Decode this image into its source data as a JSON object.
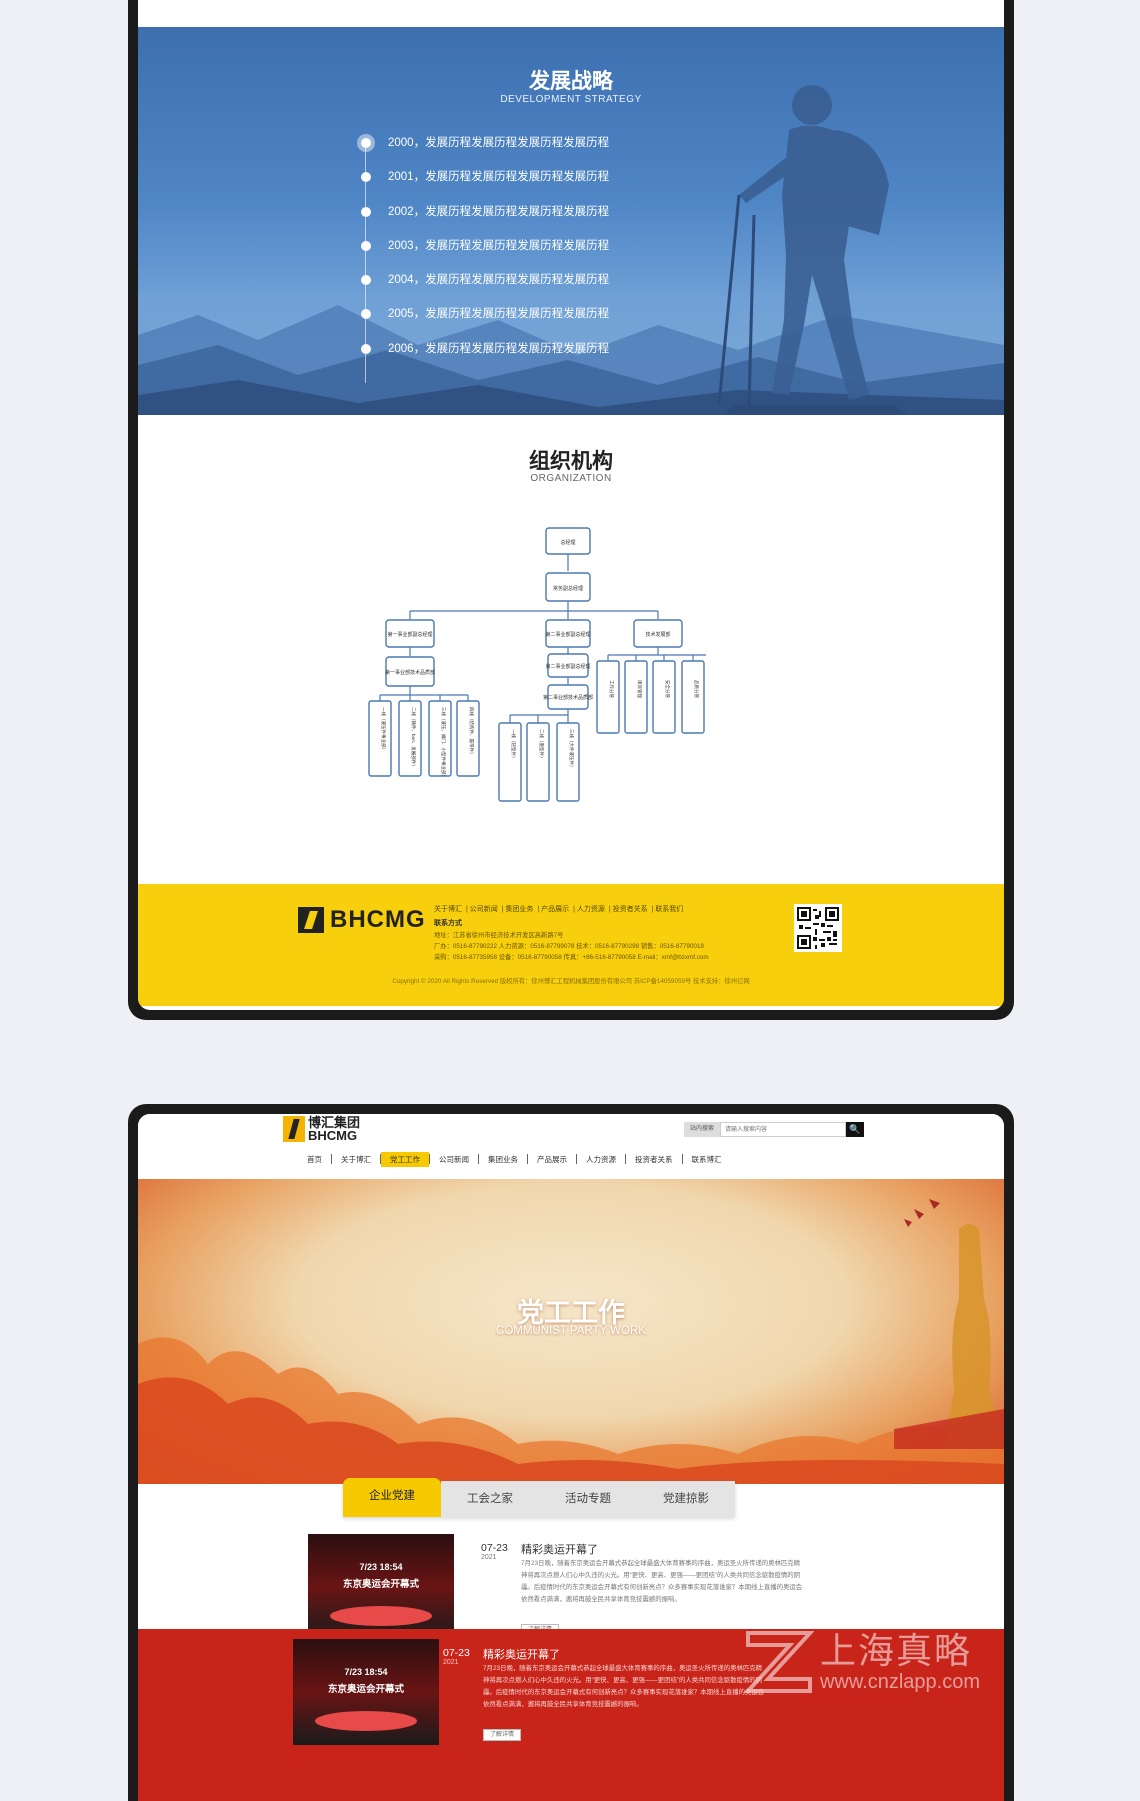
{
  "strategy": {
    "title": "发展战略",
    "subtitle": "DEVELOPMENT STRATEGY",
    "items": [
      "2000，发展历程发展历程发展历程发展历程",
      "2001，发展历程发展历程发展历程发展历程",
      "2002，发展历程发展历程发展历程发展历程",
      "2003，发展历程发展历程发展历程发展历程",
      "2004，发展历程发展历程发展历程发展历程",
      "2005，发展历程发展历程发展历程发展历程",
      "2006，发展历程发展历程发展历程发展历程"
    ]
  },
  "organization": {
    "title": "组织机构",
    "subtitle": "ORGANIZATION",
    "root": "总经理",
    "level2": "常务副总经理",
    "branches": [
      "第一事业部副总经理",
      "第二事业部副总经理",
      "技术发展部"
    ],
    "b1_sub": "第一事业部技术品质部",
    "b2_sub1": "第二事业部副总经理",
    "b2_sub2": "第二事业部技术品质部",
    "b1_leaves": [
      "一线（液压件事业部）",
      "二线（铸件、bart、发展部件）",
      "三线（液压、阀门、小型件事业部）",
      "四线（结构件、履带件）"
    ],
    "b2_leaves": [
      "一线（轻型件）",
      "二线（重型件）",
      "三线（大件液压件）"
    ],
    "b3_leaves": [
      "工作分管",
      "项目管理",
      "安全分管",
      "品质分管"
    ]
  },
  "footer": {
    "brand": "BHCMG",
    "nav": [
      "关于博汇",
      "公司新闻",
      "集团业务",
      "产品展示",
      "人力资源",
      "投资者关系",
      "联系我们"
    ],
    "contact_title": "联系方式",
    "lines": [
      "地址：江苏省徐州市经济技术开发区高新路7号",
      "厂办：0516-87790222   人力资源：0516-87799078   技术：0516-87790298   销售：0516-87790018",
      "采购：0516-87735958   设备：0516-87790058   传真：+86-516-87790058   E-mail：xmf@bzxmf.com"
    ],
    "copyright": "Copyright © 2020 All Rights Reserved 版权所有：徐州博汇工程机械集团股份有限公司 苏ICP备14059059号 技术支持：徐州亿网"
  },
  "site": {
    "logo_cn": "博汇集团",
    "logo_en": "BHCMG",
    "search_label": "站内搜索",
    "search_placeholder": "请输入搜索内容",
    "search_btn": "🔍",
    "nav": [
      "首页",
      "关于博汇",
      "党工工作",
      "公司新闻",
      "集团业务",
      "产品展示",
      "人力资源",
      "投资者关系",
      "联系博汇"
    ],
    "active_nav": 2
  },
  "party": {
    "title": "党工工作",
    "subtitle": "COMMUNIST PARTY WORK",
    "tabs": [
      "企业党建",
      "工会之家",
      "活动专题",
      "党建掠影"
    ],
    "active_tab": 0
  },
  "news": [
    {
      "date": "07-23",
      "year": "2021",
      "title": "精彩奥运开幕了",
      "thumb_time": "7/23 18:54",
      "thumb_caption": "东京奥运会开幕式",
      "body": "7月23日晚，随着东京奥运会开幕式恭起全球最盛大体育赛事的序曲，奥运圣火所传递的奥林匹克精神将再次点燃人们心中久违的火光。用“更快、更高、更强——更团结”的人类共同信念驱散疫情的阴霾。后疫情时代的东京奥运会开幕式有何创新亮点？众多赛事实现花落谁家？本期线上直播的奥运会依然看点满满，邀将再鼓全民共享体育竞技震撼的振响。",
      "btn": "了解详情"
    },
    {
      "date": "07-23",
      "year": "2021",
      "title": "精彩奥运开幕了",
      "thumb_time": "7/23 18:54",
      "thumb_caption": "东京奥运会开幕式",
      "body": "7月23日晚，随着东京奥运会开幕式恭起全球最盛大体育赛事的序曲，奥运圣火所传递的奥林匹克精神将再次点燃人们心中久违的火光。用“更快、更高、更强——更团结”的人类共同信念驱散疫情的阴霾。后疫情时代的东京奥运会开幕式有何创新亮点？众多赛事实现花落谁家？本期线上直播的奥运会依然看点满满，邀将再鼓全民共享体育竞技震撼的振响。",
      "btn": "了解详情"
    }
  ],
  "watermark": {
    "text": "上海真略",
    "url": "www.cnzlapp.com"
  }
}
